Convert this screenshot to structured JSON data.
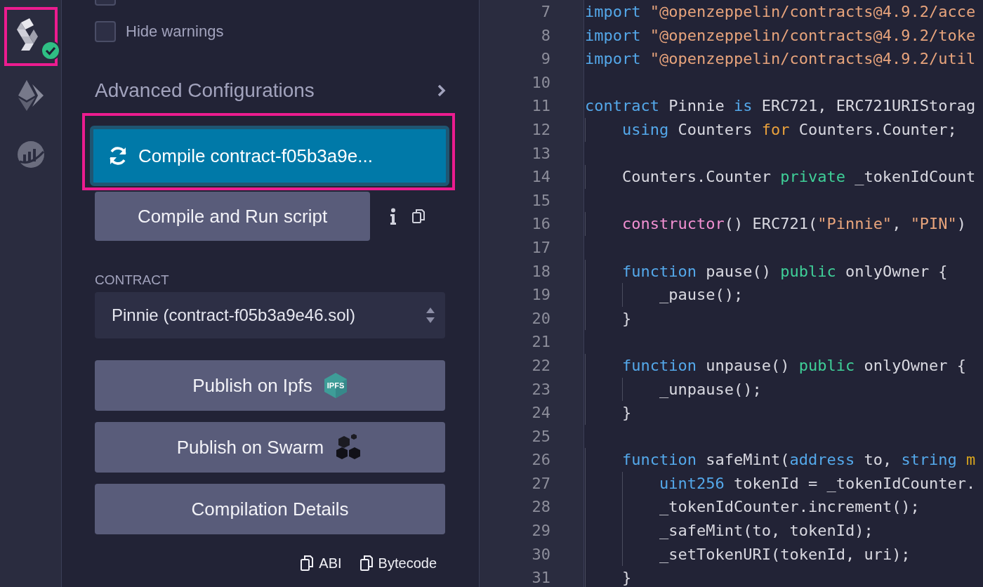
{
  "sidebar_icons": [
    {
      "kind": "compiler",
      "compiled": true,
      "highlighted": true
    },
    {
      "kind": "deploy",
      "compiled": false,
      "highlighted": false
    },
    {
      "kind": "analysis",
      "compiled": false,
      "highlighted": false
    }
  ],
  "panel": {
    "options": [
      {
        "checked": false
      },
      {
        "label": "Hide warnings",
        "checked": false
      }
    ],
    "advanced": {
      "label": "Advanced Configurations",
      "expanded": false
    },
    "compile_button": {
      "label": "Compile contract-f05b3a9e...",
      "highlighted": true
    },
    "run_script_button": {
      "label": "Compile and Run script"
    },
    "contract": {
      "label": "CONTRACT",
      "value": "Pinnie (contract-f05b3a9e46.sol)"
    },
    "publish_buttons": [
      {
        "kind": "ipfs",
        "label": "Publish on Ipfs",
        "badge_text": "IPFS"
      },
      {
        "kind": "swarm",
        "label": "Publish on Swarm"
      },
      {
        "kind": "plain",
        "label": "Compilation Details"
      }
    ],
    "copy_links": [
      "ABI",
      "Bytecode"
    ]
  },
  "editor": {
    "lines": [
      {
        "number": "7",
        "tokens": [
          {
            "t": "import",
            "kind": "keyword"
          },
          {
            "t": " \"@openzeppelin/contracts@4.9.2/acce",
            "kind": "string"
          }
        ]
      },
      {
        "number": "8",
        "tokens": [
          {
            "t": "import",
            "kind": "keyword"
          },
          {
            "t": " \"@openzeppelin/contracts@4.9.2/toke",
            "kind": "string"
          }
        ]
      },
      {
        "number": "9",
        "tokens": [
          {
            "t": "import",
            "kind": "keyword"
          },
          {
            "t": " \"@openzeppelin/contracts@4.9.2/util",
            "kind": "string"
          }
        ]
      },
      {
        "number": "10"
      },
      {
        "number": "11",
        "tokens": [
          {
            "t": "contract",
            "kind": "keyword"
          },
          {
            "t": " Pinnie ",
            "kind": "plain"
          },
          {
            "t": "is",
            "kind": "keyword"
          },
          {
            "t": " ERC721, ERC721URIStorag",
            "kind": "plain"
          }
        ]
      },
      {
        "number": "12",
        "tokens": [
          {
            "t": "    using",
            "kind": "keyword"
          },
          {
            "t": " Counters ",
            "kind": "plain"
          },
          {
            "t": "for",
            "kind": "control"
          },
          {
            "t": " Counters.Counter;",
            "kind": "plain"
          }
        ]
      },
      {
        "number": "13"
      },
      {
        "number": "14",
        "tokens": [
          {
            "t": "    Counters.Counter ",
            "kind": "plain"
          },
          {
            "t": "private",
            "kind": "modifier"
          },
          {
            "t": " _tokenIdCount",
            "kind": "plain"
          }
        ]
      },
      {
        "number": "15"
      },
      {
        "number": "16",
        "tokens": [
          {
            "t": "    constructor",
            "kind": "constructor"
          },
          {
            "t": "() ERC721(",
            "kind": "plain"
          },
          {
            "t": "\"Pinnie\"",
            "kind": "string"
          },
          {
            "t": ", ",
            "kind": "plain"
          },
          {
            "t": "\"PIN\"",
            "kind": "string"
          },
          {
            "t": ")",
            "kind": "plain"
          }
        ]
      },
      {
        "number": "17"
      },
      {
        "number": "18",
        "tokens": [
          {
            "t": "    function",
            "kind": "keyword"
          },
          {
            "t": " pause() ",
            "kind": "plain"
          },
          {
            "t": "public",
            "kind": "modifier"
          },
          {
            "t": " onlyOwner {",
            "kind": "plain"
          }
        ]
      },
      {
        "number": "19",
        "tokens": [
          {
            "t": "        _pause();",
            "kind": "plain"
          }
        ]
      },
      {
        "number": "20",
        "tokens": [
          {
            "t": "    }",
            "kind": "plain"
          }
        ]
      },
      {
        "number": "21"
      },
      {
        "number": "22",
        "tokens": [
          {
            "t": "    function",
            "kind": "keyword"
          },
          {
            "t": " unpause() ",
            "kind": "plain"
          },
          {
            "t": "public",
            "kind": "modifier"
          },
          {
            "t": " onlyOwner {",
            "kind": "plain"
          }
        ]
      },
      {
        "number": "23",
        "tokens": [
          {
            "t": "        _unpause();",
            "kind": "plain"
          }
        ]
      },
      {
        "number": "24",
        "tokens": [
          {
            "t": "    }",
            "kind": "plain"
          }
        ]
      },
      {
        "number": "25"
      },
      {
        "number": "26",
        "tokens": [
          {
            "t": "    function",
            "kind": "keyword"
          },
          {
            "t": " safeMint(",
            "kind": "plain"
          },
          {
            "t": "address",
            "kind": "keyword"
          },
          {
            "t": " to, ",
            "kind": "plain"
          },
          {
            "t": "string",
            "kind": "keyword"
          },
          {
            "t": " m",
            "kind": "parameter"
          }
        ]
      },
      {
        "number": "27",
        "tokens": [
          {
            "t": "        uint256",
            "kind": "keyword"
          },
          {
            "t": " tokenId = _tokenIdCounter.",
            "kind": "plain"
          }
        ]
      },
      {
        "number": "28",
        "tokens": [
          {
            "t": "        _tokenIdCounter.increment();",
            "kind": "plain"
          }
        ]
      },
      {
        "number": "29",
        "tokens": [
          {
            "t": "        _safeMint(to, tokenId);",
            "kind": "plain"
          }
        ]
      },
      {
        "number": "30",
        "tokens": [
          {
            "t": "        _setTokenURI(tokenId, uri);",
            "kind": "plain"
          }
        ]
      },
      {
        "number": "31",
        "tokens": [
          {
            "t": "    }",
            "kind": "plain"
          }
        ]
      }
    ]
  }
}
